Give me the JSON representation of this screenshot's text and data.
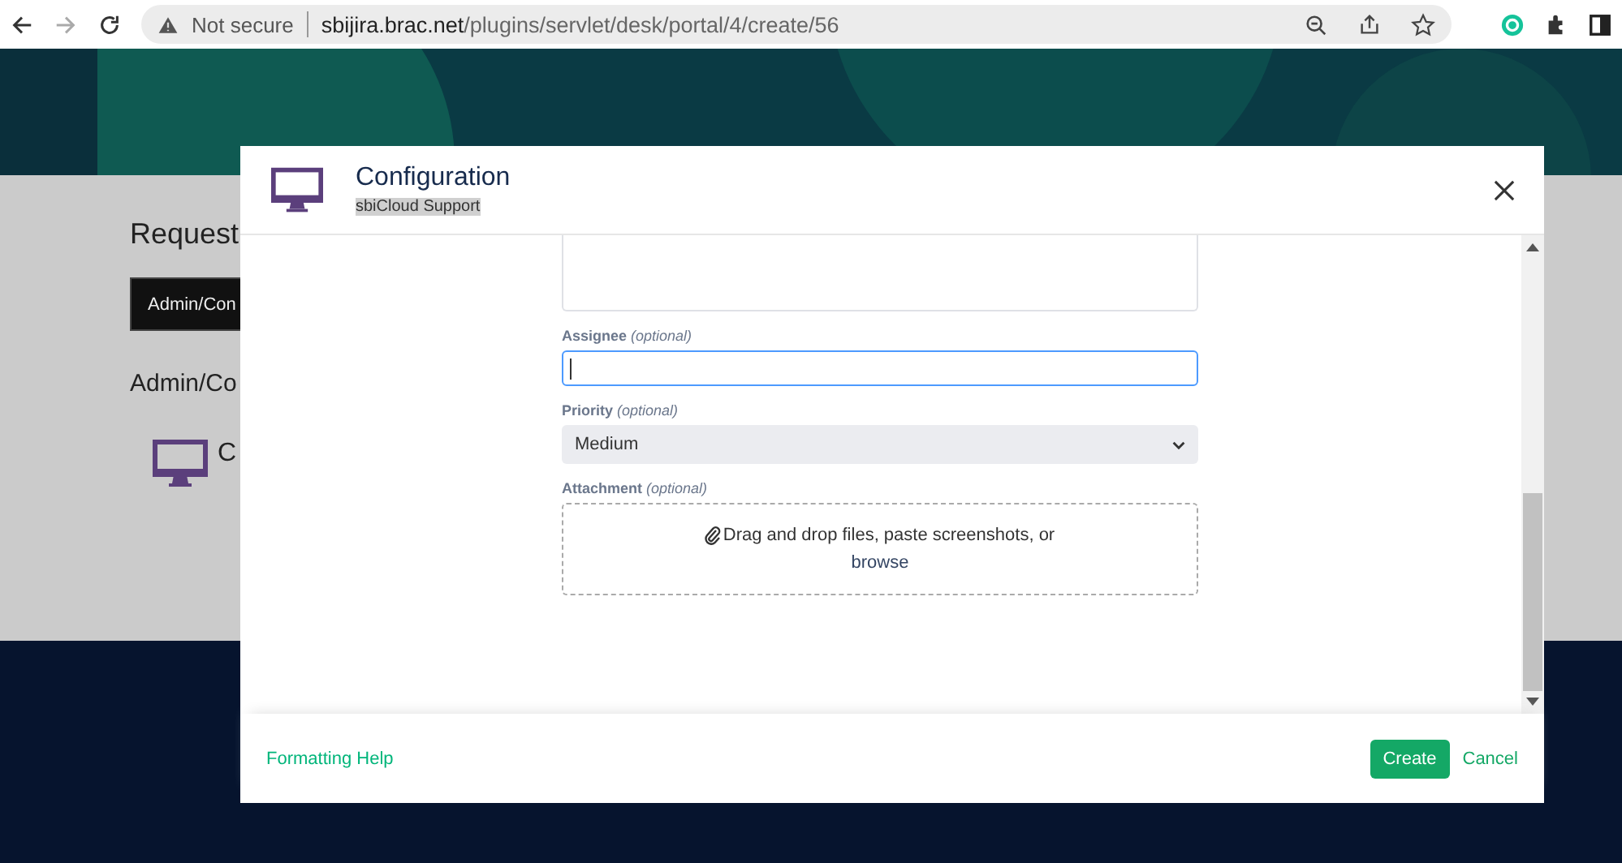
{
  "browser": {
    "security": "Not secure",
    "url_host": "sbijira.brac.net",
    "url_path": "/plugins/servlet/desk/portal/4/create/56"
  },
  "page": {
    "heading": "Request",
    "type_button": "Admin/Con",
    "section_title": "Admin/Co",
    "item_title": "C"
  },
  "modal": {
    "title": "Configuration",
    "subtitle": "sbiCloud Support",
    "fields": [
      {
        "kind": "text",
        "label": "Assignee",
        "optional": "(optional)",
        "focused": true
      },
      {
        "kind": "select",
        "label": "Priority",
        "optional": "(optional)",
        "value": "Medium"
      },
      {
        "kind": "attachment",
        "label": "Attachment",
        "optional": "(optional)",
        "text": "Drag and drop files, paste screenshots, or",
        "link": "browse"
      }
    ],
    "footer": {
      "help": "Formatting Help",
      "submit": "Create",
      "cancel": "Cancel"
    }
  }
}
